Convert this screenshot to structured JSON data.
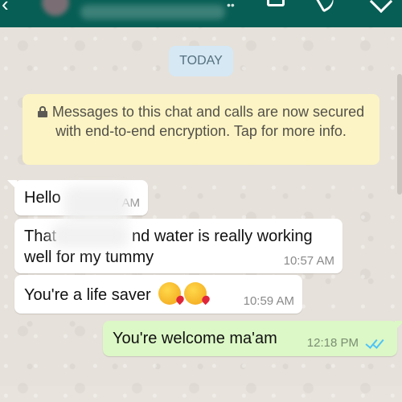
{
  "header": {
    "back_icon": "back-arrow-icon",
    "menu_icons": [
      "video-call-icon",
      "voice-call-icon",
      "more-options-icon"
    ],
    "bar_color": "#075e54"
  },
  "date_chip": "TODAY",
  "encryption_notice": {
    "icon": "lock-icon",
    "text": "Messages to this chat and calls are now secured with end-to-end encryption. Tap for more info."
  },
  "messages": [
    {
      "direction": "incoming",
      "text": "Hello",
      "time": "7 AM"
    },
    {
      "direction": "incoming",
      "line1": "That",
      "line1b": "nd water is really working",
      "line2": "well for my tummy",
      "time": "10:57 AM"
    },
    {
      "direction": "incoming",
      "text": "You're a life saver",
      "time": "10:59 AM",
      "emoji": [
        "kissing-heart-emoji",
        "kissing-heart-emoji"
      ]
    },
    {
      "direction": "outgoing",
      "text": "You're welcome ma'am",
      "time": "12:18 PM",
      "status_icon": "double-tick-read-icon"
    }
  ],
  "colors": {
    "incoming_bubble": "#ffffff",
    "outgoing_bubble": "#dcf8c6",
    "notice_bg": "#fcf4c4",
    "date_chip_bg": "#d5e8f4",
    "read_tick": "#4fc3f7"
  }
}
